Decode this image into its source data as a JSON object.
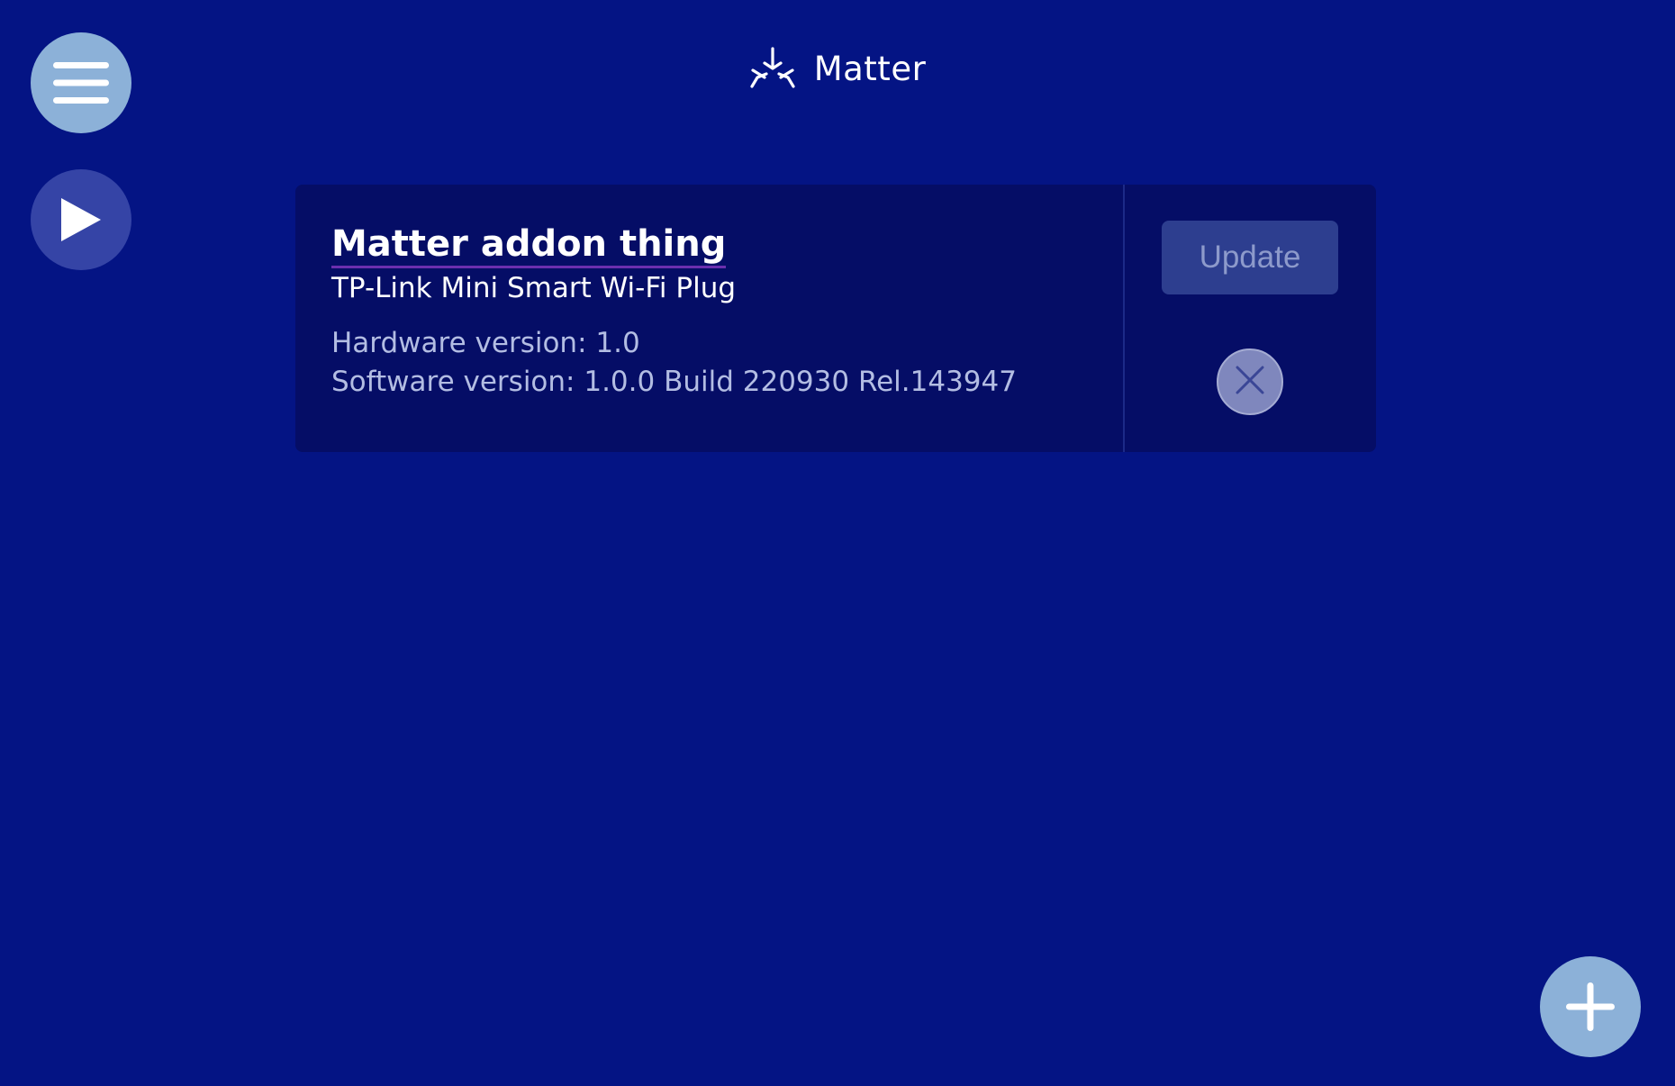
{
  "header": {
    "icon": "matter-logo-icon",
    "title": "Matter"
  },
  "nav": {
    "menu_icon": "hamburger-menu-icon",
    "play_icon": "play-icon",
    "add_icon": "plus-icon"
  },
  "thing": {
    "title": "Matter addon thing",
    "model": "TP-Link Mini Smart Wi-Fi Plug",
    "hardware_version": "Hardware version: 1.0",
    "software_version": "Software version: 1.0.0 Build 220930 Rel.143947",
    "update_label": "Update",
    "remove_icon": "close-icon"
  },
  "colors": {
    "background": "#041484",
    "card": "#050d66",
    "light_button": "#8cb1d8",
    "dark_button": "#3544a6",
    "title_underline": "#6b2fae"
  }
}
